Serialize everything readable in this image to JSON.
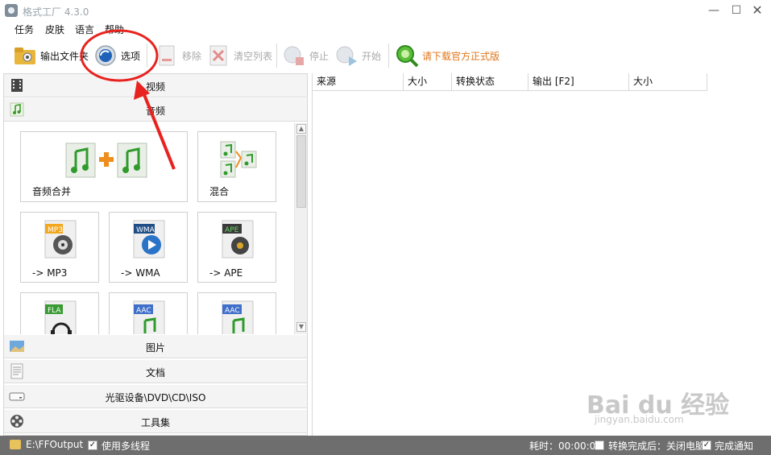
{
  "window": {
    "title": "格式工厂 4.3.0",
    "min": "—",
    "max": "☐",
    "close": "✕"
  },
  "menu": [
    "任务",
    "皮肤",
    "语言",
    "帮助"
  ],
  "toolbar": {
    "output_folder": "输出文件夹",
    "options": "选项",
    "remove": "移除",
    "clear_list": "清空列表",
    "stop": "停止",
    "start": "开始",
    "download": "请下载官方正式版"
  },
  "categories": {
    "video": "视频",
    "audio": "音频",
    "image": "图片",
    "document": "文档",
    "optical": "光驱设备\\DVD\\CD\\ISO",
    "tools": "工具集"
  },
  "tiles": {
    "merge": "音频合并",
    "mix": "混合",
    "mp3": "-> MP3",
    "wma": "-> WMA",
    "ape": "-> APE",
    "fla_badge": "FLA",
    "aac_badge": "AAC",
    "mp3_badge": "MP3",
    "wma_badge": "WMA",
    "ape_badge": "APE"
  },
  "columns": [
    "来源",
    "大小",
    "转换状态",
    "输出 [F2]",
    "大小"
  ],
  "status": {
    "output_path": "E:\\FFOutput",
    "multithread": "使用多线程",
    "elapsed": "耗时：00:00:00",
    "after_done": "转换完成后：关闭电脑",
    "notify": "完成通知"
  },
  "watermark": {
    "main": "Bai du 经验",
    "sub": "jingyan.baidu.com"
  },
  "colors": {
    "accent": "#e0761b",
    "annotation": "#e8231f",
    "statusbar": "#6e6e6e"
  }
}
